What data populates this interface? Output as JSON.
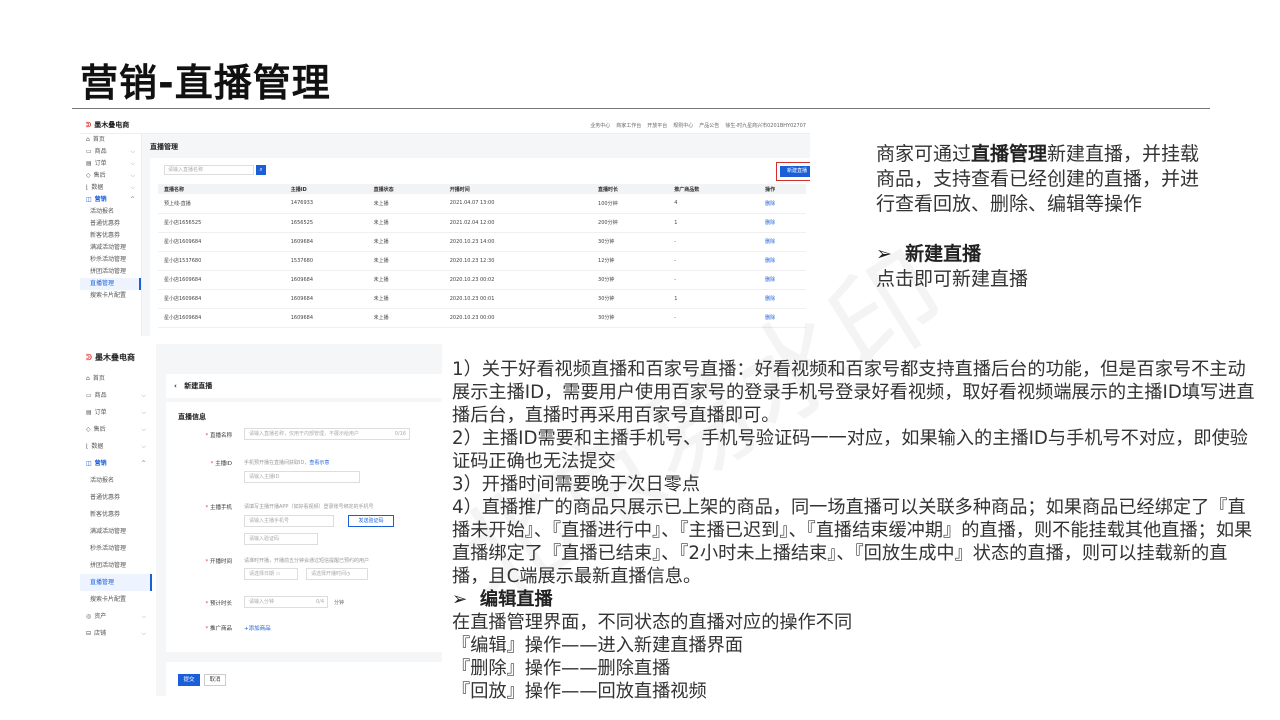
{
  "slide": {
    "title": "营销-直播管理",
    "watermark": "北京易水印"
  },
  "app": {
    "logo_text": "墨木叠电商",
    "top_nav": [
      "业务中心",
      "商家工作台",
      "开放平台",
      "规则中心",
      "产品公告",
      "徐生-时九星商兴市0201BHY02707"
    ]
  },
  "list_screen": {
    "sidebar": [
      {
        "label": "首页",
        "icon": "home-icon",
        "type": "top"
      },
      {
        "label": "商品",
        "icon": "product-icon",
        "type": "top",
        "chevron": "⌵"
      },
      {
        "label": "订单",
        "icon": "order-icon",
        "type": "top",
        "chevron": "⌵"
      },
      {
        "label": "售后",
        "icon": "aftersale-icon",
        "type": "top",
        "chevron": "⌵"
      },
      {
        "label": "数据",
        "icon": "chart-icon",
        "type": "top",
        "chevron": "⌵"
      },
      {
        "label": "营销",
        "icon": "marketing-icon",
        "type": "active",
        "chevron": "^"
      },
      {
        "label": "活动报名",
        "type": "sub"
      },
      {
        "label": "普通优惠券",
        "type": "sub"
      },
      {
        "label": "新客优惠券",
        "type": "sub"
      },
      {
        "label": "满减活动管理",
        "type": "sub"
      },
      {
        "label": "秒杀活动管理",
        "type": "sub"
      },
      {
        "label": "拼团活动管理",
        "type": "sub"
      },
      {
        "label": "直播管理",
        "type": "current"
      },
      {
        "label": "搜索卡片配置",
        "type": "sub"
      }
    ],
    "page_title": "直播管理",
    "search_placeholder": "请输入直播名称",
    "new_button": "新建直播",
    "columns": [
      "直播名称",
      "主播ID",
      "直播状态",
      "开播时间",
      "直播时长",
      "推广商品数",
      "操作"
    ],
    "rows": [
      [
        "预上线-直播",
        "1476933",
        "未上播",
        "2021.04.07 13:00",
        "100分钟",
        "4",
        "删除"
      ],
      [
        "星小店1656525",
        "1656525",
        "未上播",
        "2021.02.04 12:00",
        "200分钟",
        "1",
        "删除"
      ],
      [
        "星小店1609684",
        "1609684",
        "未上播",
        "2020.10.23 14:00",
        "30分钟",
        "-",
        "删除"
      ],
      [
        "星小店1537680",
        "1537680",
        "未上播",
        "2020.10.23 12:30",
        "12分钟",
        "-",
        "删除"
      ],
      [
        "星小店1609684",
        "1609684",
        "未上播",
        "2020.10.23 00:02",
        "30分钟",
        "-",
        "删除"
      ],
      [
        "星小店1609684",
        "1609684",
        "未上播",
        "2020.10.23 00:01",
        "30分钟",
        "1",
        "删除"
      ],
      [
        "星小店1609684",
        "1609684",
        "未上播",
        "2020.10.23 00:00",
        "30分钟",
        "-",
        "删除"
      ]
    ]
  },
  "create_screen": {
    "sidebar": [
      {
        "label": "首页",
        "icon": "home-icon",
        "type": "top"
      },
      {
        "label": "商品",
        "icon": "product-icon",
        "type": "top",
        "chevron": "⌵"
      },
      {
        "label": "订单",
        "icon": "order-icon",
        "type": "top",
        "chevron": "⌵"
      },
      {
        "label": "售后",
        "icon": "aftersale-icon",
        "type": "top",
        "chevron": "⌵"
      },
      {
        "label": "数据",
        "icon": "chart-icon",
        "type": "top",
        "chevron": "⌵"
      },
      {
        "label": "营销",
        "icon": "marketing-icon",
        "type": "active",
        "chevron": "^"
      },
      {
        "label": "活动报名",
        "type": "sub"
      },
      {
        "label": "普通优惠券",
        "type": "sub"
      },
      {
        "label": "新客优惠券",
        "type": "sub"
      },
      {
        "label": "满减活动管理",
        "type": "sub"
      },
      {
        "label": "秒杀活动管理",
        "type": "sub"
      },
      {
        "label": "拼团活动管理",
        "type": "sub"
      },
      {
        "label": "直播管理",
        "type": "current"
      },
      {
        "label": "搜索卡片配置",
        "type": "sub"
      },
      {
        "label": "资产",
        "icon": "asset-icon",
        "type": "top",
        "chevron": "⌵"
      },
      {
        "label": "店铺",
        "icon": "shop-icon",
        "type": "top",
        "chevron": "⌵"
      }
    ],
    "back_icon": "‹",
    "page_title": "新建直播",
    "section_title": "直播信息",
    "fields": {
      "name_label": "直播名称",
      "name_placeholder": "请输入直播名称，仅用于内部管理，不展示给用户",
      "name_counter": "0/16",
      "anchor_id_label": "主播ID",
      "anchor_id_hint": "手机预开播在直播间获取ID，",
      "anchor_id_hint_link": "查看示意",
      "anchor_id_placeholder": "请输入主播ID",
      "phone_label": "主播手机",
      "phone_hint": "请填写主播开播APP（如好看视频）登录账号绑定的手机号",
      "phone_placeholder": "请输入主播手机号",
      "send_code_button": "发送验证码",
      "code_placeholder": "请输入验证码",
      "start_label": "开播时间",
      "start_hint": "请准时开播，开播前五分钟会通过短信提醒已预约的用户",
      "date_placeholder": "请选择日期",
      "date_icon": "▭",
      "time_placeholder": "请选择开播时间",
      "time_icon": "◷",
      "duration_label": "预计时长",
      "duration_placeholder": "请输入分钟",
      "duration_counter": "0/4",
      "duration_unit": "分钟",
      "promo_label": "推广商品",
      "promo_link": "+添加商品",
      "required_mark": "*"
    },
    "submit_button": "提交",
    "cancel_button": "取消"
  },
  "right_text": {
    "p1_before": "商家可通过",
    "p1_bold": "直播管理",
    "p1_after": "新建直播，并挂载商品，支持查看已经创建的直播，并进行查看回放、删除、编辑等操作",
    "bullet_mark": "➢",
    "bullet_title": "新建直播",
    "bullet_desc": "点击即可新建直播"
  },
  "bottom_text": {
    "p1": "1）关于好看视频直播和百家号直播：好看视频和百家号都支持直播后台的功能，但是百家号不主动展示主播ID，需要用户使用百家号的登录手机号登录好看视频，取好看视频端展示的主播ID填写进直播后台，直播时再采用百家号直播即可。",
    "p2": "2）主播ID需要和主播手机号、手机号验证码一一对应，如果输入的主播ID与手机号不对应，即使验证码正确也无法提交",
    "p3": "3）开播时间需要晚于次日零点",
    "p4": "4）直播推广的商品只展示已上架的商品，同一场直播可以关联多种商品；如果商品已经绑定了『直播未开始』、『直播进行中』、『主播已迟到』、『直播结束缓冲期』的直播，则不能挂载其他直播；如果直播绑定了『直播已结束』、『2小时未上播结束』、『回放生成中』状态的直播，则可以挂载新的直播，且C端展示最新直播信息。",
    "bullet_mark": "➢",
    "bullet_title": "编辑直播",
    "p5": "在直播管理界面，不同状态的直播对应的操作不同",
    "op1": "『编辑』操作——进入新建直播界面",
    "op2": "『删除』操作——删除直播",
    "op3": "『回放』操作——回放直播视频"
  }
}
